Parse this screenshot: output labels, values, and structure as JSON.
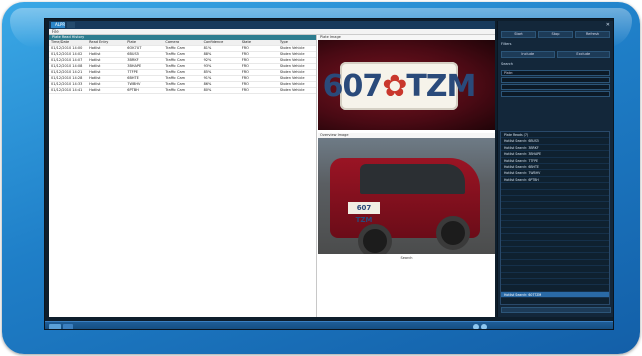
{
  "window": {
    "tab_active": "ALPR",
    "tab_other": "",
    "menu": [
      "File",
      "",
      "",
      ""
    ]
  },
  "grid": {
    "title": "Plate Read History",
    "columns": [
      "Time/Date",
      "Read Entry",
      "Plate",
      "Camera",
      "Confidence",
      "State",
      "Type"
    ],
    "rows": [
      [
        "01/12/2010 14:00",
        "Hotlist",
        "6OK7UT",
        "Traffic Cam",
        "81%",
        "FRO",
        "Stolen Vehicle"
      ],
      [
        "01/12/2010 14:02",
        "Hotlist",
        "6BUS5",
        "Traffic Cam",
        "88%",
        "FRO",
        "Stolen Vehicle"
      ],
      [
        "01/12/2010 14:07",
        "Hotlist",
        "3BRKF",
        "Traffic Cam",
        "92%",
        "FRO",
        "Stolen Vehicle"
      ],
      [
        "01/12/2010 14:08",
        "Hotlist",
        "3BHAPE",
        "Traffic Cam",
        "93%",
        "FRO",
        "Stolen Vehicle"
      ],
      [
        "01/12/2010 14:21",
        "Hotlist",
        "7TFPE",
        "Traffic Cam",
        "85%",
        "FRO",
        "Stolen Vehicle"
      ],
      [
        "01/12/2010 14:28",
        "Hotlist",
        "6BHTE",
        "Traffic Cam",
        "91%",
        "FRO",
        "Stolen Vehicle"
      ],
      [
        "01/12/2010 14:33",
        "Hotlist",
        "7WBHV",
        "Traffic Cam",
        "86%",
        "FRO",
        "Stolen Vehicle"
      ],
      [
        "01/12/2010 14:41",
        "Hotlist",
        "6PTBH",
        "Traffic Cam",
        "80%",
        "FRO",
        "Stolen Vehicle"
      ]
    ]
  },
  "preview": {
    "plate_caption": "Plate Image",
    "plate_text": "607",
    "plate_text2": "TZM",
    "overview_caption": "Overview Image",
    "mini_plate": "607 TZM",
    "overlay_line1": "",
    "overlay_line2": "",
    "bottom_label": "Search"
  },
  "sidebar": {
    "title": "",
    "buttons": [
      "Start",
      "Stop",
      "Refresh"
    ],
    "section1": "Filters",
    "field_btns": [
      "Include",
      "Exclude"
    ],
    "section2": "Search",
    "search_btn": "",
    "plate_label": "Plate:",
    "field_a": "",
    "field_b": "",
    "field_c": "",
    "list": [
      "Plate Reads (7)",
      "Hotlist Search: 6BUS5",
      "Hotlist Search: 3BRKF",
      "Hotlist Search: 3BHAPE",
      "Hotlist Search: 7TFPE",
      "Hotlist Search: 6BHTE",
      "Hotlist Search: 7WBHV",
      "Hotlist Search: 6PTBH",
      "",
      "",
      "",
      "",
      "",
      "",
      "",
      "",
      "",
      "",
      "",
      "",
      "",
      "",
      "",
      "",
      "",
      "Hotlist Search: 607TZM"
    ],
    "footer_btn": ""
  },
  "taskbar": {
    "clock": ""
  }
}
